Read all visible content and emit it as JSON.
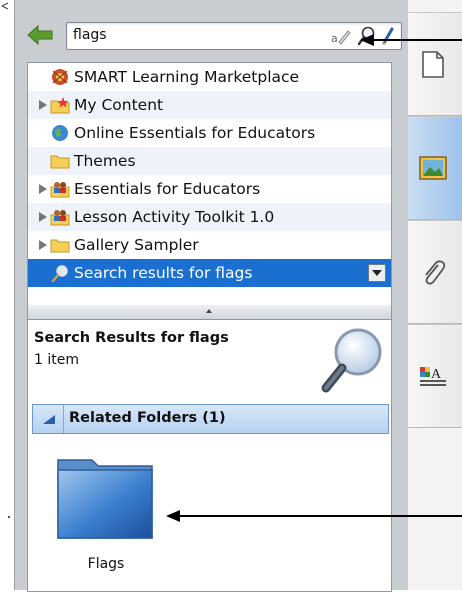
{
  "search": {
    "value": "flags",
    "tools": [
      "eraser-pencil-icon",
      "search-icon",
      "brush-icon"
    ]
  },
  "tree": {
    "items": [
      {
        "label": "SMART Learning Marketplace",
        "icon": "marketplace-icon",
        "expandable": false
      },
      {
        "label": "My Content",
        "icon": "star-folder-icon",
        "expandable": true
      },
      {
        "label": "Online Essentials for Educators",
        "icon": "globe-icon",
        "expandable": false
      },
      {
        "label": "Themes",
        "icon": "folder-icon",
        "expandable": false
      },
      {
        "label": "Essentials for Educators",
        "icon": "people-folder-icon",
        "expandable": true
      },
      {
        "label": "Lesson Activity Toolkit 1.0",
        "icon": "people-folder-icon",
        "expandable": true
      },
      {
        "label": "Gallery Sampler",
        "icon": "folder-icon",
        "expandable": true
      },
      {
        "label": "Search results for flags",
        "icon": "search-result-icon",
        "expandable": false,
        "selected": true
      }
    ]
  },
  "results": {
    "title": "Search Results for flags",
    "count": "1 item",
    "related_label": "Related Folders (1)",
    "folder_label": "Flags"
  },
  "tabs": [
    "page-sorter-tab",
    "gallery-tab",
    "attachments-tab",
    "properties-tab"
  ],
  "colors": {
    "selection": "#1b6fd1",
    "panel": "#c9ccd0",
    "related_header": "#b5d1f1",
    "back_arrow": "#5c9c2e"
  }
}
